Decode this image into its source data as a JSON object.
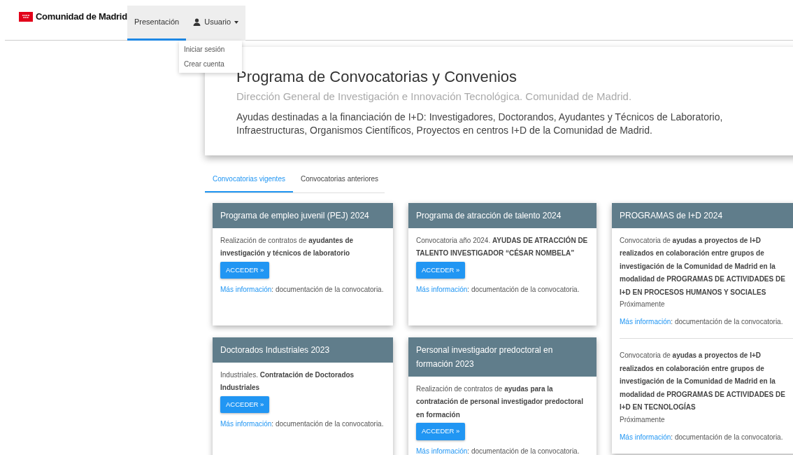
{
  "brand": {
    "name": "Comunidad de Madrid"
  },
  "nav": [
    {
      "kind": "link",
      "label": "Presentación",
      "selected": true
    },
    {
      "kind": "dropdown",
      "label": "Usuario",
      "selected": false,
      "expanded": true,
      "items": [
        "Iniciar sesión",
        "Crear cuenta"
      ]
    }
  ],
  "header": {
    "title": "Programa de Convocatorias y Convenios",
    "subtitle": "Dirección General de Investigación e Innovación Tecnológica. Comunidad de Madrid.",
    "description": "Ayudas destinadas a la financiación de I+D: Investigadores, Doctorandos, Ayudantes y Técnicos de Laboratorio, Infraestructuras, Organismos Científicos, Proyectos en centros I+D de la Comunidad de Madrid."
  },
  "tabs": [
    {
      "label": "Convocatorias vigentes",
      "selected": true
    },
    {
      "label": "Convocatorias anteriores",
      "selected": false
    }
  ],
  "columns": [
    [
      {
        "title": "Programa de empleo juvenil (PEJ) 2024",
        "entries": [
          {
            "text": "Realización de contratos de **ayudantes de investigación y técnicos de laboratorio**",
            "button": "ACCEDER »",
            "more_link": "Más información",
            "more_text": ": documentación de la convocatoria."
          }
        ]
      },
      {
        "title": "Doctorados Industriales 2023",
        "entries": [
          {
            "text": "Industriales. **Contratación de Doctorados Industriales**",
            "button": "ACCEDER »",
            "more_link": "Más información",
            "more_text": ": documentación de la convocatoria."
          }
        ]
      }
    ],
    [
      {
        "title": "Programa de atracción de talento 2024",
        "entries": [
          {
            "text": "Convocatoria año 2024. **AYUDAS DE ATRACCIÓN DE TALENTO INVESTIGADOR “CÉSAR NOMBELA”**",
            "button": "ACCEDER »",
            "more_link": "Más información",
            "more_text": ": documentación de la convocatoria."
          }
        ]
      },
      {
        "title": "Personal investigador predoctoral en formación 2023",
        "entries": [
          {
            "text": "Realización de contratos de **ayudas para la contratación de personal investigador predoctoral en formación**",
            "button": "ACCEDER »",
            "more_link": "Más información",
            "more_text": ": documentación de la convocatoria."
          }
        ]
      }
    ],
    [
      {
        "title": "PROGRAMAS de I+D 2024",
        "entries": [
          {
            "text": "Convocatoria de **ayudas a proyectos de I+D realizados en colaboración entre grupos de investigación de la Comunidad de Madrid en la modalidad de PROGRAMAS DE ACTIVIDADES DE I+D EN PROCESOS HUMANOS Y SOCIALES**",
            "status": "Próximamente",
            "more_link": "Más información",
            "more_text": ": documentación de la convocatoria."
          },
          {
            "text": "Convocatoria de **ayudas a proyectos de I+D realizados en colaboración entre grupos de investigación de la Comunidad de Madrid en la modalidad de PROGRAMAS DE ACTIVIDADES DE I+D EN TECNOLOGÍAS**",
            "status": "Próximamente",
            "more_link": "Más información",
            "more_text": ": documentación de la convocatoria."
          }
        ]
      }
    ]
  ]
}
